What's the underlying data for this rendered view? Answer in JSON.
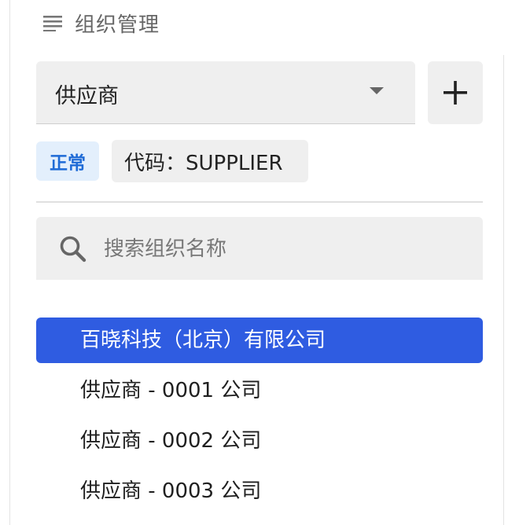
{
  "header": {
    "title": "组织管理",
    "icon": "menu-icon"
  },
  "org_select": {
    "value": "供应商",
    "icon": "caret-down-icon"
  },
  "add_button": {
    "label": "+",
    "icon": "plus-icon"
  },
  "tags": {
    "status": "正常",
    "code": "代码：SUPPLIER"
  },
  "search": {
    "placeholder": "搜索组织名称",
    "value": "",
    "icon": "search-icon"
  },
  "org_list": [
    {
      "label": "百晓科技（北京）有限公司",
      "selected": true
    },
    {
      "label": "供应商 - 0001 公司",
      "selected": false
    },
    {
      "label": "供应商 - 0002 公司",
      "selected": false
    },
    {
      "label": "供应商 - 0003 公司",
      "selected": false
    }
  ],
  "colors": {
    "accent": "#2f5ce1",
    "status_bg": "#e3effc",
    "status_text": "#1f6bd6",
    "field_bg": "#efefef"
  }
}
